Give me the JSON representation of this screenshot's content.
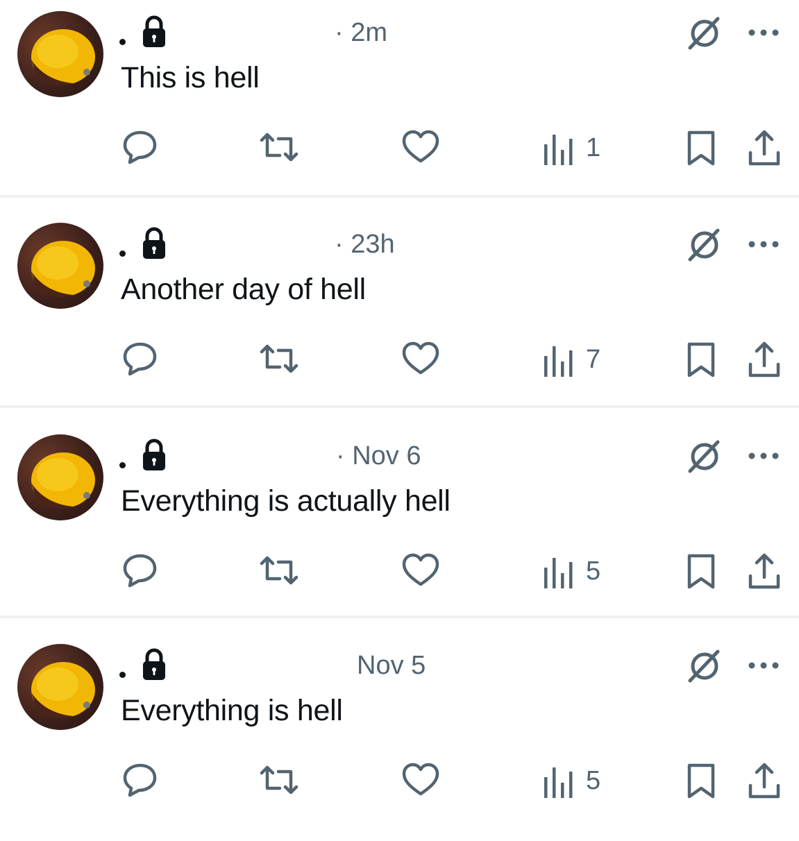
{
  "colors": {
    "text": "#0f1419",
    "secondary": "#536471",
    "divider": "#eff1f3",
    "avatar_fish": "#f2b705"
  },
  "icons": {
    "lock": "lock-icon",
    "grok": "grok-icon",
    "more": "more-icon",
    "reply": "reply-icon",
    "repost": "repost-icon",
    "like": "like-icon",
    "views": "views-icon",
    "bookmark": "bookmark-icon",
    "share": "share-icon"
  },
  "posts": [
    {
      "timestamp": "· 2m",
      "text": "This is hell",
      "views": "1"
    },
    {
      "timestamp": "· 23h",
      "text": "Another day of hell",
      "views": "7"
    },
    {
      "timestamp": "· Nov 6",
      "text": "Everything is actually hell",
      "views": "5"
    },
    {
      "timestamp": "Nov 5",
      "text": "Everything is hell",
      "views": "5"
    }
  ]
}
